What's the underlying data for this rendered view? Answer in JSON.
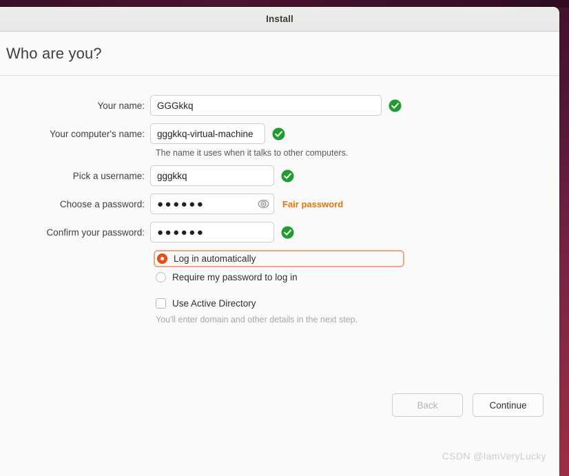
{
  "window": {
    "title": "Install"
  },
  "page": {
    "title": "Who are you?"
  },
  "form": {
    "fields": [
      {
        "label": "Your name:",
        "value": "GGGkkq",
        "placeholder": "",
        "status": "valid"
      },
      {
        "label": "Your computer's name:",
        "value": "gggkkq-virtual-machine",
        "placeholder": "",
        "status": "valid",
        "hint": "The name it uses when it talks to other computers."
      },
      {
        "label": "Pick a username:",
        "value": "gggkkq",
        "placeholder": "",
        "status": "valid"
      },
      {
        "label": "Choose a password:",
        "value": "●●●●●●",
        "placeholder": "",
        "status": "strength",
        "strength_text": "Fair password",
        "reveal_icon": "eye-icon"
      },
      {
        "label": "Confirm your password:",
        "value": "●●●●●●",
        "placeholder": "",
        "status": "valid"
      }
    ]
  },
  "options": {
    "login_auto": {
      "label": "Log in automatically",
      "selected": true,
      "focused": true
    },
    "login_password": {
      "label": "Require my password to log in",
      "selected": false
    },
    "active_directory": {
      "label": "Use Active Directory",
      "checked": false,
      "hint": "You'll enter domain and other details in the next step."
    }
  },
  "footer": {
    "back_label": "Back",
    "back_disabled": true,
    "continue_label": "Continue",
    "continue_disabled": false
  },
  "watermark": {
    "text": "CSDN @IamVeryLucky"
  },
  "colors": {
    "accent_orange": "#e8511a",
    "strength_orange": "#e8730a",
    "valid_green": "#1f9d2f",
    "focus_ring": "#f0a884",
    "desktop_plum": "#4b1433",
    "desktop_maroon": "#9d2f43"
  }
}
